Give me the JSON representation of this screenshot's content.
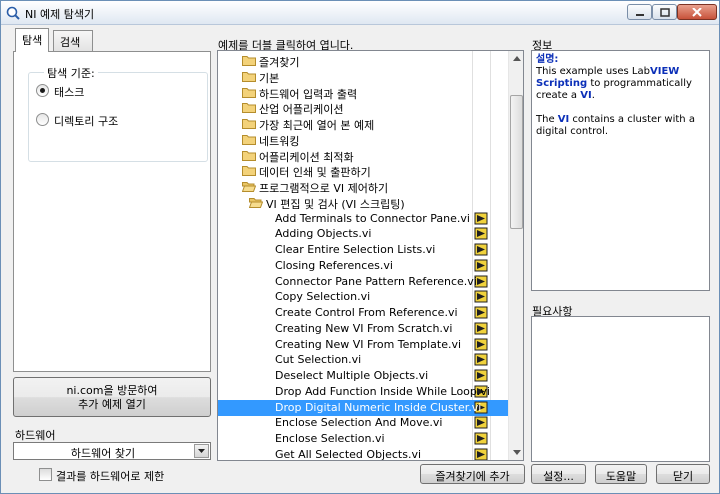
{
  "window": {
    "title": "NI 예제 탐색기",
    "accent": "#3399ff"
  },
  "tabs": [
    {
      "label": "탐색"
    },
    {
      "label": "검색"
    }
  ],
  "browse": {
    "group_label": "탐색 기준:",
    "options": [
      {
        "label": "태스크",
        "selected": true
      },
      {
        "label": "디렉토리 구조",
        "selected": false
      }
    ],
    "visit_button": {
      "line1": "ni.com을 방문하여",
      "line2": "추가 예제 열기"
    },
    "hardware_label": "하드웨어",
    "hardware_select": {
      "value": "하드웨어 찾기"
    },
    "limit_checkbox": {
      "label": "결과를 하드웨어로 제한",
      "checked": false
    }
  },
  "list": {
    "header": "예제를 더블 클릭하여 엽니다.",
    "items": [
      {
        "label": "즐겨찾기",
        "kind": "folder",
        "indent": 0
      },
      {
        "label": "기본",
        "kind": "folder",
        "indent": 0
      },
      {
        "label": "하드웨어 입력과 출력",
        "kind": "folder",
        "indent": 0
      },
      {
        "label": "산업 어플리케이션",
        "kind": "folder",
        "indent": 0
      },
      {
        "label": "가장 최근에 열어 본 예제",
        "kind": "folder",
        "indent": 0
      },
      {
        "label": "네트워킹",
        "kind": "folder",
        "indent": 0
      },
      {
        "label": "어플리케이션 최적화",
        "kind": "folder",
        "indent": 0
      },
      {
        "label": "데이터 인쇄 및 출판하기",
        "kind": "folder",
        "indent": 0
      },
      {
        "label": "프로그램적으로 VI 제어하기",
        "kind": "open-folder",
        "indent": 0
      },
      {
        "label": "VI 편집 및 검사 (VI 스크립팅)",
        "kind": "open-folder",
        "indent": 1
      },
      {
        "label": "Add Terminals to Connector Pane.vi",
        "kind": "vi",
        "indent": 2
      },
      {
        "label": "Adding Objects.vi",
        "kind": "vi",
        "indent": 2
      },
      {
        "label": "Clear Entire Selection Lists.vi",
        "kind": "vi",
        "indent": 2
      },
      {
        "label": "Closing References.vi",
        "kind": "vi",
        "indent": 2
      },
      {
        "label": "Connector Pane Pattern Reference.vi",
        "kind": "vi",
        "indent": 2
      },
      {
        "label": "Copy Selection.vi",
        "kind": "vi",
        "indent": 2
      },
      {
        "label": "Create Control From Reference.vi",
        "kind": "vi",
        "indent": 2
      },
      {
        "label": "Creating New VI From Scratch.vi",
        "kind": "vi",
        "indent": 2
      },
      {
        "label": "Creating New VI From Template.vi",
        "kind": "vi",
        "indent": 2
      },
      {
        "label": "Cut Selection.vi",
        "kind": "vi",
        "indent": 2
      },
      {
        "label": "Deselect Multiple Objects.vi",
        "kind": "vi",
        "indent": 2
      },
      {
        "label": "Drop Add Function Inside While Loop.vi",
        "kind": "vi",
        "indent": 2
      },
      {
        "label": "Drop Digital Numeric Inside Cluster.vi",
        "kind": "vi",
        "indent": 2,
        "selected": true
      },
      {
        "label": "Enclose Selection And Move.vi",
        "kind": "vi",
        "indent": 2
      },
      {
        "label": "Enclose Selection.vi",
        "kind": "vi",
        "indent": 2
      },
      {
        "label": "Get All Selected Objects.vi",
        "kind": "vi",
        "indent": 2
      }
    ]
  },
  "info": {
    "label": "정보",
    "desc_title": "설명:",
    "p1": [
      "This example uses Lab",
      "VIEW",
      " ",
      "Scripting",
      " to programmatically create a ",
      "VI",
      "."
    ],
    "p2": [
      "The ",
      "VI",
      " contains a cluster with a digital control."
    ]
  },
  "requirements": {
    "label": "필요사항"
  },
  "buttons": {
    "add_favorite": "즐겨찾기에 추가",
    "settings": "설정...",
    "help": "도움말",
    "close": "닫기"
  }
}
